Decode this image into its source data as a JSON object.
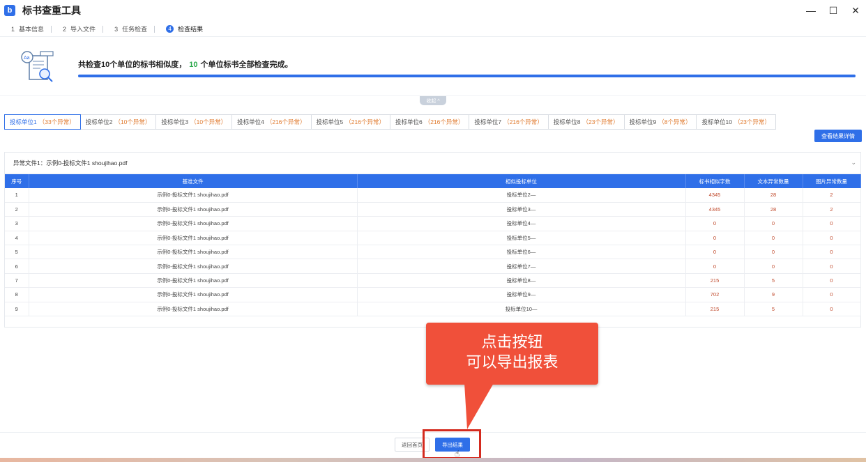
{
  "window": {
    "title": "标书查重工具",
    "logo": "b"
  },
  "window_controls": [
    "—",
    "☐",
    "✕"
  ],
  "steps": [
    {
      "num": "1",
      "label": "基本信息",
      "active": false
    },
    {
      "num": "2",
      "label": "导入文件",
      "active": false
    },
    {
      "num": "3",
      "label": "任务检查",
      "active": false
    },
    {
      "num": "4",
      "label": "检查结果",
      "active": true
    }
  ],
  "summary": {
    "prefix": "共检查10个单位的标书相似度，",
    "count": "10",
    "suffix": "个单位标书全部检查完成。",
    "progress_fraction": 1.0
  },
  "collapse_label": "收起 ^",
  "unit_tabs": [
    {
      "label": "投标单位1",
      "count": "（33个异常）",
      "active": true
    },
    {
      "label": "投标单位2",
      "count": "（10个异常）",
      "active": false
    },
    {
      "label": "投标单位3",
      "count": "（10个异常）",
      "active": false
    },
    {
      "label": "投标单位4",
      "count": "（216个异常）",
      "active": false
    },
    {
      "label": "投标单位5",
      "count": "（216个异常）",
      "active": false
    },
    {
      "label": "投标单位6",
      "count": "（216个异常）",
      "active": false
    },
    {
      "label": "投标单位7",
      "count": "（216个异常）",
      "active": false
    },
    {
      "label": "投标单位8",
      "count": "（23个异常）",
      "active": false
    },
    {
      "label": "投标单位9",
      "count": "（8个异常）",
      "active": false
    },
    {
      "label": "投标单位10",
      "count": "（23个异常）",
      "active": false
    }
  ],
  "detail_button": "查看结果详情",
  "file_section": {
    "title": "异常文件1：示例0-投标文件1 shoujihao.pdf"
  },
  "table": {
    "headers": [
      "序号",
      "基准文件",
      "相似投标单位",
      "标书相似字数",
      "文本异常数量",
      "图片异常数量"
    ],
    "rows": [
      [
        "1",
        "示例0-投标文件1 shoujihao.pdf",
        "投标单位2—",
        "4345",
        "28",
        "2"
      ],
      [
        "2",
        "示例0-投标文件1 shoujihao.pdf",
        "投标单位3—",
        "4345",
        "28",
        "2"
      ],
      [
        "3",
        "示例0-投标文件1 shoujihao.pdf",
        "投标单位4—",
        "0",
        "0",
        "0"
      ],
      [
        "4",
        "示例0-投标文件1 shoujihao.pdf",
        "投标单位5—",
        "0",
        "0",
        "0"
      ],
      [
        "5",
        "示例0-投标文件1 shoujihao.pdf",
        "投标单位6—",
        "0",
        "0",
        "0"
      ],
      [
        "6",
        "示例0-投标文件1 shoujihao.pdf",
        "投标单位7—",
        "0",
        "0",
        "0"
      ],
      [
        "7",
        "示例0-投标文件1 shoujihao.pdf",
        "投标单位8—",
        "215",
        "5",
        "0"
      ],
      [
        "8",
        "示例0-投标文件1 shoujihao.pdf",
        "投标单位9—",
        "702",
        "9",
        "0"
      ],
      [
        "9",
        "示例0-投标文件1 shoujihao.pdf",
        "投标单位10—",
        "215",
        "5",
        "0"
      ]
    ]
  },
  "bottom": {
    "back_label": "返回首页",
    "export_label": "导出结果"
  },
  "callout": {
    "line1": "点击按钮",
    "line2": "可以导出报表",
    "color": "#f0503a"
  },
  "colors": {
    "accent": "#2f6fe8",
    "highlight": "#d42a1e",
    "count_orange": "#e07a2e",
    "value_red": "#c04a2c",
    "success_green": "#2aa84a"
  }
}
